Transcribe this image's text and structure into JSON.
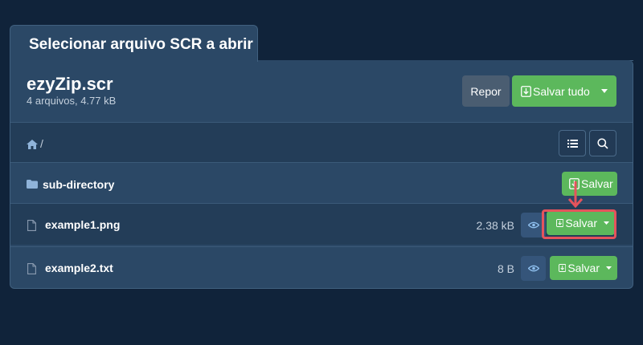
{
  "dialog": {
    "title": "Selecionar arquivo SCR a abrir"
  },
  "archive": {
    "name": "ezyZip.scr",
    "meta": "4 arquivos, 4.77 kB"
  },
  "toolbar": {
    "reset_label": "Repor",
    "save_all_label": "Salvar tudo"
  },
  "path": {
    "current": "/"
  },
  "icons": {
    "home": "home-icon",
    "list": "list-icon",
    "search": "search-icon",
    "folder": "folder-icon",
    "file": "file-icon",
    "eye": "eye-icon",
    "download": "download-icon",
    "caret": "caret-down-icon",
    "annotation_arrow": "arrow-down-icon"
  },
  "entries": [
    {
      "type": "folder",
      "name": "sub-directory",
      "size": "",
      "save_label": "Salvar"
    },
    {
      "type": "file",
      "name": "example1.png",
      "size": "2.38 kB",
      "save_label": "Salvar"
    },
    {
      "type": "file",
      "name": "example2.txt",
      "size": "8 B",
      "save_label": "Salvar"
    }
  ],
  "colors": {
    "background": "#10233a",
    "panel": "#2b4866",
    "accent_green": "#5cb85c",
    "neutral_button": "#4a5d71",
    "highlight_red": "#e5535c"
  }
}
